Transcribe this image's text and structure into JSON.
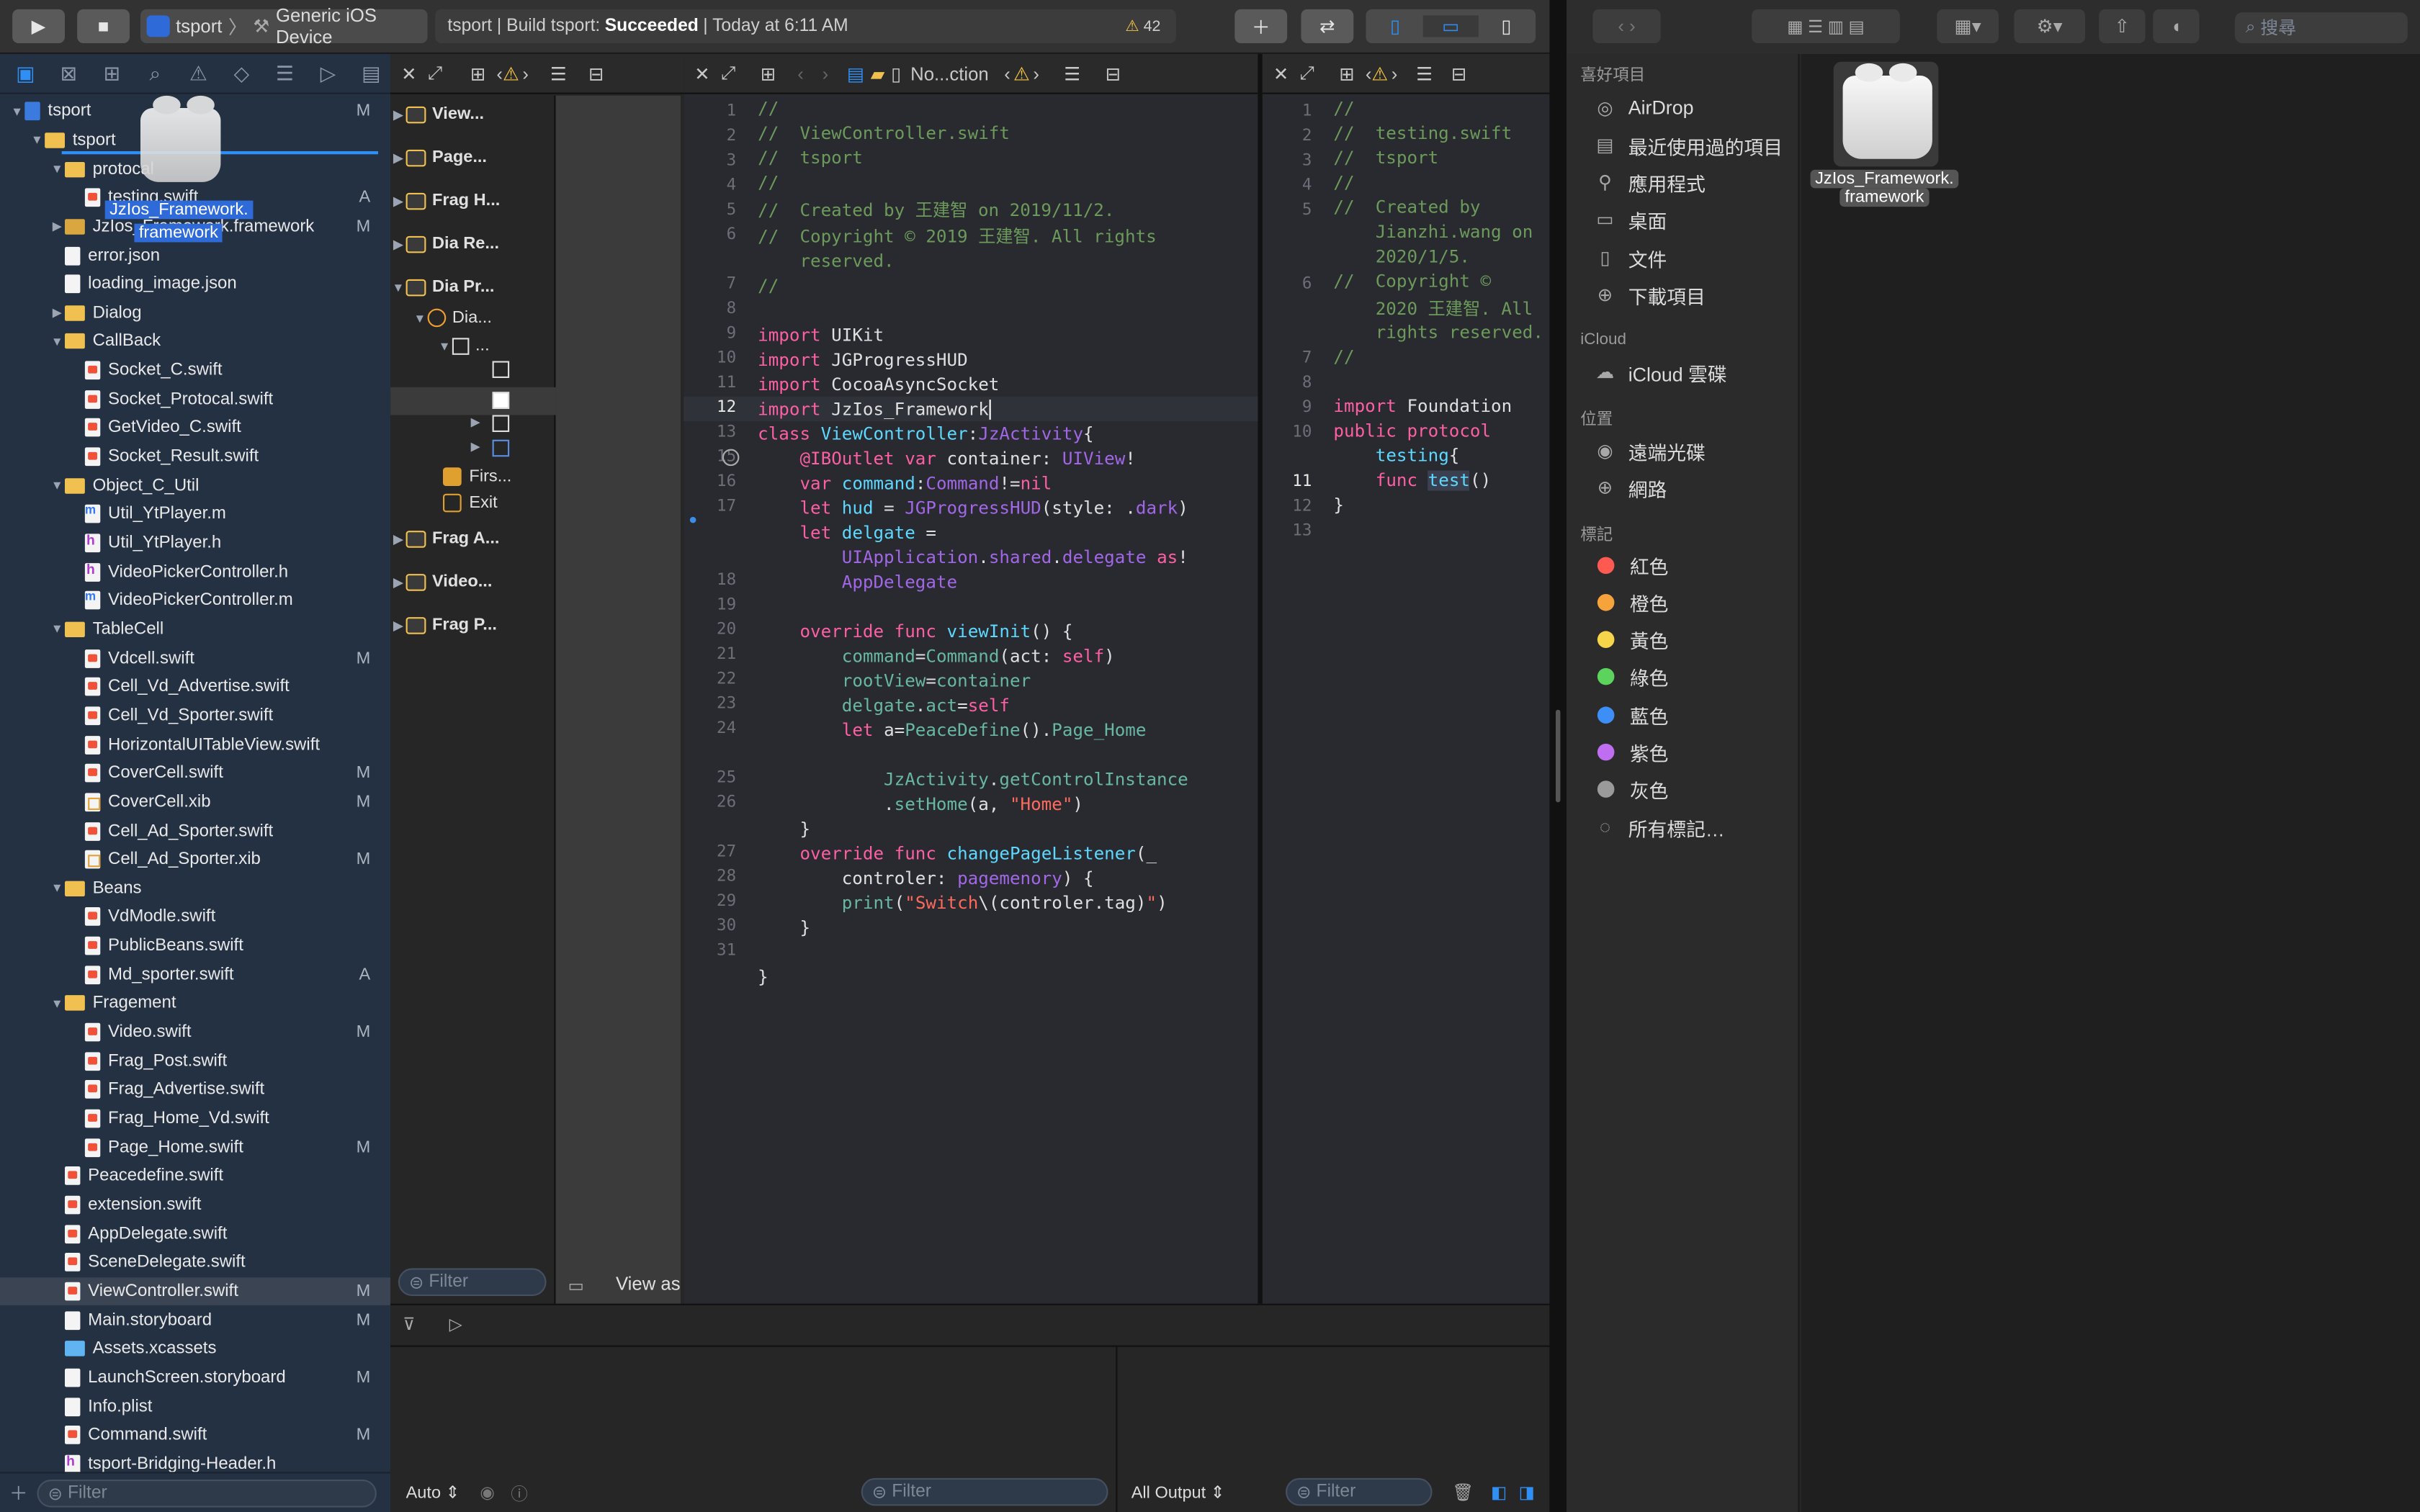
{
  "toolbar": {
    "scheme": "tsport",
    "device": "Generic iOS Device",
    "status_prefix": "tsport | Build tsport:",
    "status_result": "Succeeded",
    "status_time": "| Today at 6:11 AM",
    "warning_count": "42"
  },
  "navigator": {
    "items": [
      {
        "label": "tsport",
        "kind": "project",
        "indent": 0,
        "open": true,
        "badge": "M"
      },
      {
        "label": "tsport",
        "kind": "folder",
        "indent": 1,
        "open": true,
        "badge": ""
      },
      {
        "label": "protocal",
        "kind": "folder",
        "indent": 2,
        "open": true,
        "badge": ""
      },
      {
        "label": "testing.swift",
        "kind": "swift",
        "indent": 3,
        "badge": "A"
      },
      {
        "label": "JzIos_Framework.framework",
        "kind": "framework",
        "indent": 2,
        "open": false,
        "badge": "M"
      },
      {
        "label": "error.json",
        "kind": "plain",
        "indent": 2,
        "badge": ""
      },
      {
        "label": "loading_image.json",
        "kind": "plain",
        "indent": 2,
        "badge": ""
      },
      {
        "label": "Dialog",
        "kind": "folder",
        "indent": 2,
        "open": false,
        "badge": ""
      },
      {
        "label": "CallBack",
        "kind": "folder",
        "indent": 2,
        "open": true,
        "badge": ""
      },
      {
        "label": "Socket_C.swift",
        "kind": "swift",
        "indent": 3,
        "badge": ""
      },
      {
        "label": "Socket_Protocal.swift",
        "kind": "swift",
        "indent": 3,
        "badge": ""
      },
      {
        "label": "GetVideo_C.swift",
        "kind": "swift",
        "indent": 3,
        "badge": ""
      },
      {
        "label": "Socket_Result.swift",
        "kind": "swift",
        "indent": 3,
        "badge": ""
      },
      {
        "label": "Object_C_Util",
        "kind": "folder",
        "indent": 2,
        "open": true,
        "badge": ""
      },
      {
        "label": "Util_YtPlayer.m",
        "kind": "m",
        "indent": 3,
        "badge": ""
      },
      {
        "label": "Util_YtPlayer.h",
        "kind": "h",
        "indent": 3,
        "badge": ""
      },
      {
        "label": "VideoPickerController.h",
        "kind": "h",
        "indent": 3,
        "badge": ""
      },
      {
        "label": "VideoPickerController.m",
        "kind": "m",
        "indent": 3,
        "badge": ""
      },
      {
        "label": "TableCell",
        "kind": "folder",
        "indent": 2,
        "open": true,
        "badge": ""
      },
      {
        "label": "Vdcell.swift",
        "kind": "swift",
        "indent": 3,
        "badge": "M"
      },
      {
        "label": "Cell_Vd_Advertise.swift",
        "kind": "swift",
        "indent": 3,
        "badge": ""
      },
      {
        "label": "Cell_Vd_Sporter.swift",
        "kind": "swift",
        "indent": 3,
        "badge": ""
      },
      {
        "label": "HorizontalUITableView.swift",
        "kind": "swift",
        "indent": 3,
        "badge": ""
      },
      {
        "label": "CoverCell.swift",
        "kind": "swift",
        "indent": 3,
        "badge": "M"
      },
      {
        "label": "CoverCell.xib",
        "kind": "xib",
        "indent": 3,
        "badge": "M"
      },
      {
        "label": "Cell_Ad_Sporter.swift",
        "kind": "swift",
        "indent": 3,
        "badge": ""
      },
      {
        "label": "Cell_Ad_Sporter.xib",
        "kind": "xib",
        "indent": 3,
        "badge": "M"
      },
      {
        "label": "Beans",
        "kind": "folder",
        "indent": 2,
        "open": true,
        "badge": ""
      },
      {
        "label": "VdModle.swift",
        "kind": "swift",
        "indent": 3,
        "badge": ""
      },
      {
        "label": "PublicBeans.swift",
        "kind": "swift",
        "indent": 3,
        "badge": ""
      },
      {
        "label": "Md_sporter.swift",
        "kind": "swift",
        "indent": 3,
        "badge": "A"
      },
      {
        "label": "Fragement",
        "kind": "folder",
        "indent": 2,
        "open": true,
        "badge": ""
      },
      {
        "label": "Video.swift",
        "kind": "swift",
        "indent": 3,
        "badge": "M"
      },
      {
        "label": "Frag_Post.swift",
        "kind": "swift",
        "indent": 3,
        "badge": ""
      },
      {
        "label": "Frag_Advertise.swift",
        "kind": "swift",
        "indent": 3,
        "badge": ""
      },
      {
        "label": "Frag_Home_Vd.swift",
        "kind": "swift",
        "indent": 3,
        "badge": ""
      },
      {
        "label": "Page_Home.swift",
        "kind": "swift",
        "indent": 3,
        "badge": "M"
      },
      {
        "label": "Peacedefine.swift",
        "kind": "swift",
        "indent": 2,
        "badge": ""
      },
      {
        "label": "extension.swift",
        "kind": "swift",
        "indent": 2,
        "badge": ""
      },
      {
        "label": "AppDelegate.swift",
        "kind": "swift",
        "indent": 2,
        "badge": ""
      },
      {
        "label": "SceneDelegate.swift",
        "kind": "swift",
        "indent": 2,
        "badge": ""
      },
      {
        "label": "ViewController.swift",
        "kind": "swift",
        "indent": 2,
        "badge": "M",
        "selected": true
      },
      {
        "label": "Main.storyboard",
        "kind": "plain",
        "indent": 2,
        "badge": "M"
      },
      {
        "label": "Assets.xcassets",
        "kind": "assets",
        "indent": 2,
        "badge": ""
      },
      {
        "label": "LaunchScreen.storyboard",
        "kind": "plain",
        "indent": 2,
        "badge": "M"
      },
      {
        "label": "Info.plist",
        "kind": "plain",
        "indent": 2,
        "badge": ""
      },
      {
        "label": "Command.swift",
        "kind": "swift",
        "indent": 2,
        "badge": "M"
      },
      {
        "label": "tsport-Bridging-Header.h",
        "kind": "h",
        "indent": 2,
        "badge": ""
      }
    ],
    "drag_label_line1": "JzIos_Framework.",
    "drag_label_line2": "framework",
    "filter_placeholder": "Filter"
  },
  "outline": {
    "items": [
      "View...",
      "Page...",
      "Frag H...",
      "Dia Re...",
      "Dia Pr...",
      "Dia...",
      "...",
      "Firs...",
      "Exit",
      "Frag A...",
      "Video...",
      "Frag P..."
    ],
    "filter_placeholder": "Filter",
    "view_as": "View as"
  },
  "editor1": {
    "breadcrumb": "No...ction",
    "current_line": "12",
    "line_numbers": [
      "1",
      "2",
      "3",
      "4",
      "5",
      "6",
      "",
      "7",
      "8",
      "9",
      "10",
      "11",
      "12",
      "13",
      "15",
      "16",
      "17",
      "",
      "",
      "18",
      "19",
      "20",
      "21",
      "22",
      "23",
      "24",
      "",
      "25",
      "26",
      "",
      "27",
      "28",
      "29",
      "30",
      "31"
    ]
  },
  "editor2": {
    "line_numbers": [
      "1",
      "2",
      "3",
      "4",
      "5",
      "",
      "",
      "6",
      "",
      "",
      "7",
      "8",
      "9",
      "10",
      "",
      "11",
      "12",
      "13"
    ]
  },
  "debug": {
    "auto_label": "Auto",
    "filter_placeholder": "Filter",
    "output_label": "All Output",
    "filter2_placeholder": "Filter"
  },
  "finder": {
    "search_placeholder": "搜尋",
    "favorites_header": "喜好項目",
    "favorites": [
      "AirDrop",
      "最近使用過的項目",
      "應用程式",
      "桌面",
      "文件",
      "下載項目"
    ],
    "icloud_header": "iCloud",
    "icloud_items": [
      "iCloud 雲碟"
    ],
    "locations_header": "位置",
    "locations": [
      "遠端光碟",
      "網路"
    ],
    "tags_header": "標記",
    "tags": [
      {
        "label": "紅色",
        "color": "#ff5a52"
      },
      {
        "label": "橙色",
        "color": "#f7a33b"
      },
      {
        "label": "黃色",
        "color": "#f7d54a"
      },
      {
        "label": "綠色",
        "color": "#5cd35c"
      },
      {
        "label": "藍色",
        "color": "#3e8ef7"
      },
      {
        "label": "紫色",
        "color": "#bf6ef2"
      },
      {
        "label": "灰色",
        "color": "#9a9a9a"
      }
    ],
    "all_tags": "所有標記…",
    "file_name_line1": "JzIos_Framework.",
    "file_name_line2": "framework"
  }
}
